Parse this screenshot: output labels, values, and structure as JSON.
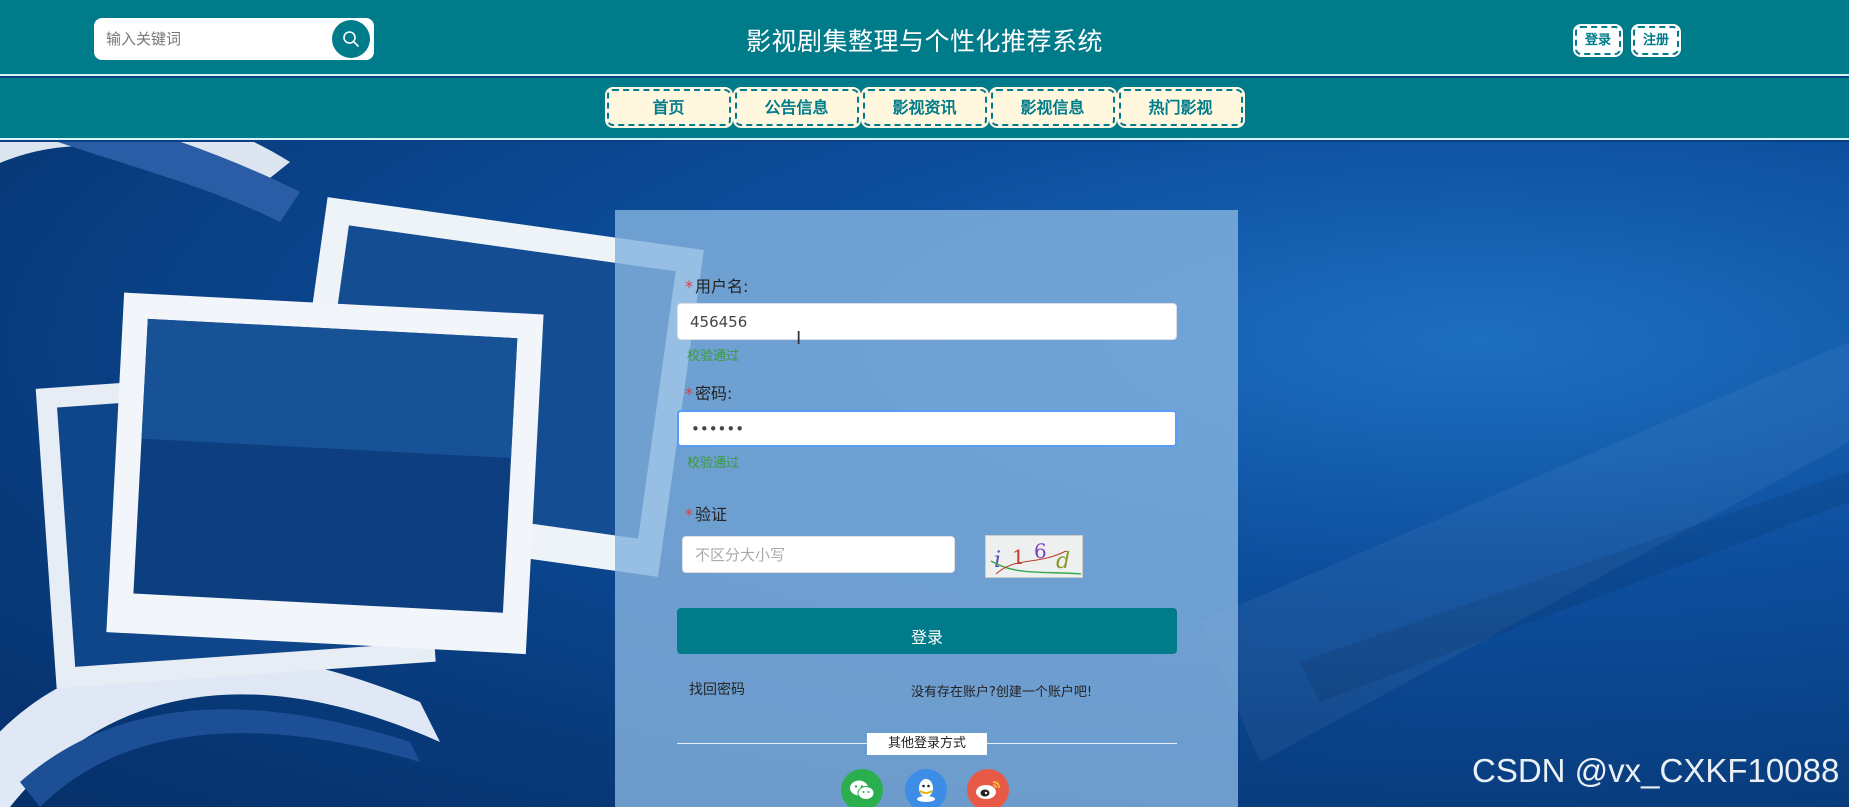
{
  "header": {
    "title": "影视剧集整理与个性化推荐系统",
    "search_placeholder": "输入关键词",
    "login_label": "登录",
    "register_label": "注册"
  },
  "nav": {
    "items": [
      "首页",
      "公告信息",
      "影视资讯",
      "影视信息",
      "热门影视"
    ]
  },
  "login_form": {
    "username_label": "用户名:",
    "username_value": "456456",
    "username_hint": "校验通过",
    "password_label": "密码:",
    "password_value": "••••••",
    "password_hint": "校验通过",
    "captcha_label": "验证",
    "captcha_placeholder": "不区分大小写",
    "captcha_text": "i16d",
    "submit_label": "登录",
    "forgot_link": "找回密码",
    "register_link": "没有存在账户?创建一个账户吧!",
    "other_methods": "其他登录方式"
  },
  "watermark": "CSDN @vx_CXKF10088",
  "colors": {
    "primary": "#007b8a",
    "success": "#3a9b3a",
    "required": "#e23b3b"
  },
  "icons": [
    "search-icon",
    "wechat-icon",
    "qq-icon",
    "weibo-icon"
  ]
}
